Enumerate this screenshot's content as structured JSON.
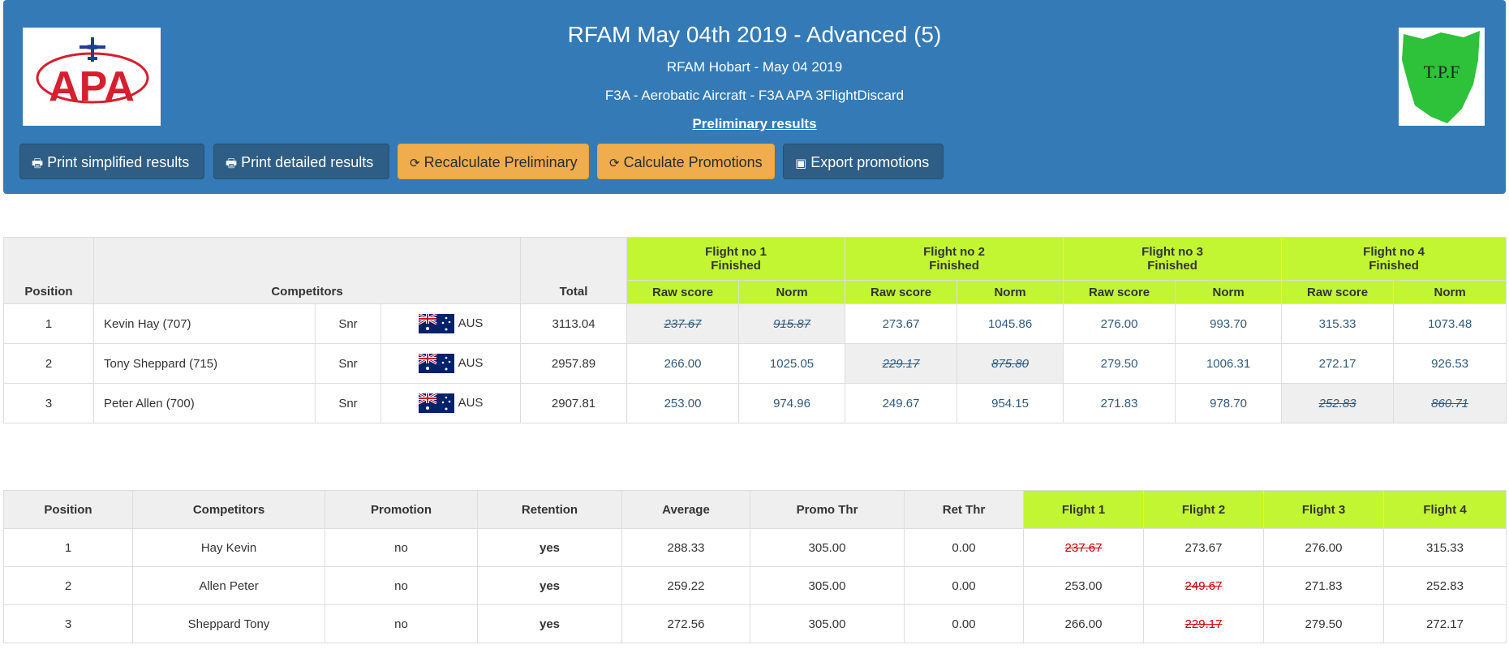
{
  "header": {
    "title": "RFAM May 04th 2019 - Advanced (5)",
    "subtitle": "RFAM Hobart - May 04 2019",
    "category": "F3A - Aerobatic Aircraft - F3A APA 3FlightDiscard",
    "status": "Preliminary results",
    "logo_left_text": "APA",
    "logo_right_text": "T.P.F"
  },
  "toolbar": {
    "print_simplified": "Print simplified results",
    "print_detailed": "Print detailed results",
    "recalculate": "Recalculate Preliminary",
    "calc_promotions": "Calculate Promotions",
    "export_promotions": "Export promotions"
  },
  "results": {
    "headers": {
      "position": "Position",
      "competitors": "Competitors",
      "total": "Total",
      "raw": "Raw score",
      "norm": "Norm"
    },
    "flights": [
      {
        "name": "Flight no 1",
        "status": "Finished"
      },
      {
        "name": "Flight no 2",
        "status": "Finished"
      },
      {
        "name": "Flight no 3",
        "status": "Finished"
      },
      {
        "name": "Flight no 4",
        "status": "Finished"
      }
    ],
    "rows": [
      {
        "position": "1",
        "name": "Kevin Hay (707)",
        "class": "Snr",
        "country": "AUS",
        "total": "3113.04",
        "scores": [
          [
            "237.67",
            "915.87"
          ],
          [
            "273.67",
            "1045.86"
          ],
          [
            "276.00",
            "993.70"
          ],
          [
            "315.33",
            "1073.48"
          ]
        ],
        "discard": 0
      },
      {
        "position": "2",
        "name": "Tony Sheppard (715)",
        "class": "Snr",
        "country": "AUS",
        "total": "2957.89",
        "scores": [
          [
            "266.00",
            "1025.05"
          ],
          [
            "229.17",
            "875.80"
          ],
          [
            "279.50",
            "1006.31"
          ],
          [
            "272.17",
            "926.53"
          ]
        ],
        "discard": 1
      },
      {
        "position": "3",
        "name": "Peter Allen (700)",
        "class": "Snr",
        "country": "AUS",
        "total": "2907.81",
        "scores": [
          [
            "253.00",
            "974.96"
          ],
          [
            "249.67",
            "954.15"
          ],
          [
            "271.83",
            "978.70"
          ],
          [
            "252.83",
            "860.71"
          ]
        ],
        "discard": 3
      }
    ]
  },
  "promotions": {
    "headers": [
      "Position",
      "Competitors",
      "Promotion",
      "Retention",
      "Average",
      "Promo Thr",
      "Ret Thr",
      "Flight 1",
      "Flight 2",
      "Flight 3",
      "Flight 4"
    ],
    "rows": [
      {
        "position": "1",
        "name": "Hay Kevin",
        "promotion": "no",
        "retention": "yes",
        "average": "288.33",
        "promo_thr": "305.00",
        "ret_thr": "0.00",
        "flights": [
          "237.67",
          "273.67",
          "276.00",
          "315.33"
        ],
        "discard": 0
      },
      {
        "position": "2",
        "name": "Allen Peter",
        "promotion": "no",
        "retention": "yes",
        "average": "259.22",
        "promo_thr": "305.00",
        "ret_thr": "0.00",
        "flights": [
          "253.00",
          "249.67",
          "271.83",
          "252.83"
        ],
        "discard": 1
      },
      {
        "position": "3",
        "name": "Sheppard Tony",
        "promotion": "no",
        "retention": "yes",
        "average": "272.56",
        "promo_thr": "305.00",
        "ret_thr": "0.00",
        "flights": [
          "266.00",
          "229.17",
          "279.50",
          "272.17"
        ],
        "discard": 1
      }
    ]
  }
}
